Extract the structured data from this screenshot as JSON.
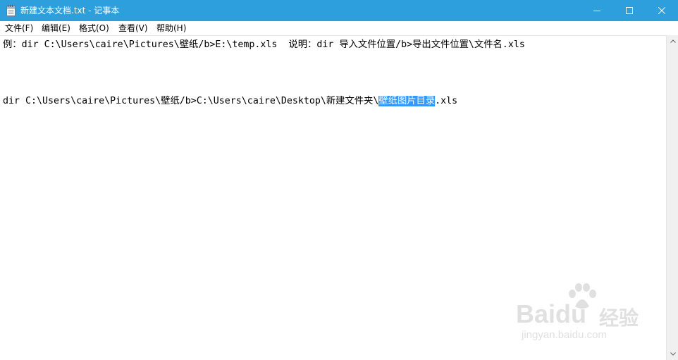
{
  "window": {
    "title": "新建文本文档.txt - 记事本",
    "icon": "notepad-icon",
    "controls": [
      "minimize-icon",
      "maximize-icon",
      "close-icon"
    ],
    "accent_color": "#2d9fdc"
  },
  "menubar": {
    "items": [
      {
        "label": "文件(F)"
      },
      {
        "label": "编辑(E)"
      },
      {
        "label": "格式(O)"
      },
      {
        "label": "查看(V)"
      },
      {
        "label": "帮助(H)"
      }
    ]
  },
  "editor": {
    "line1": "例：dir C:\\Users\\caire\\Pictures\\壁纸/b>E:\\temp.xls  说明：dir 导入文件位置/b>导出文件位置\\文件名.xls",
    "line2_before": "dir C:\\Users\\caire\\Pictures\\壁纸/b>C:\\Users\\caire\\Desktop\\新建文件夹\\",
    "line2_selected": "壁纸图片目录",
    "line2_after": ".xls",
    "selection_color": "#3399ff"
  },
  "watermark": {
    "brand": "Baidu",
    "suffix": "经验",
    "url": "jingyan.baidu.com"
  }
}
